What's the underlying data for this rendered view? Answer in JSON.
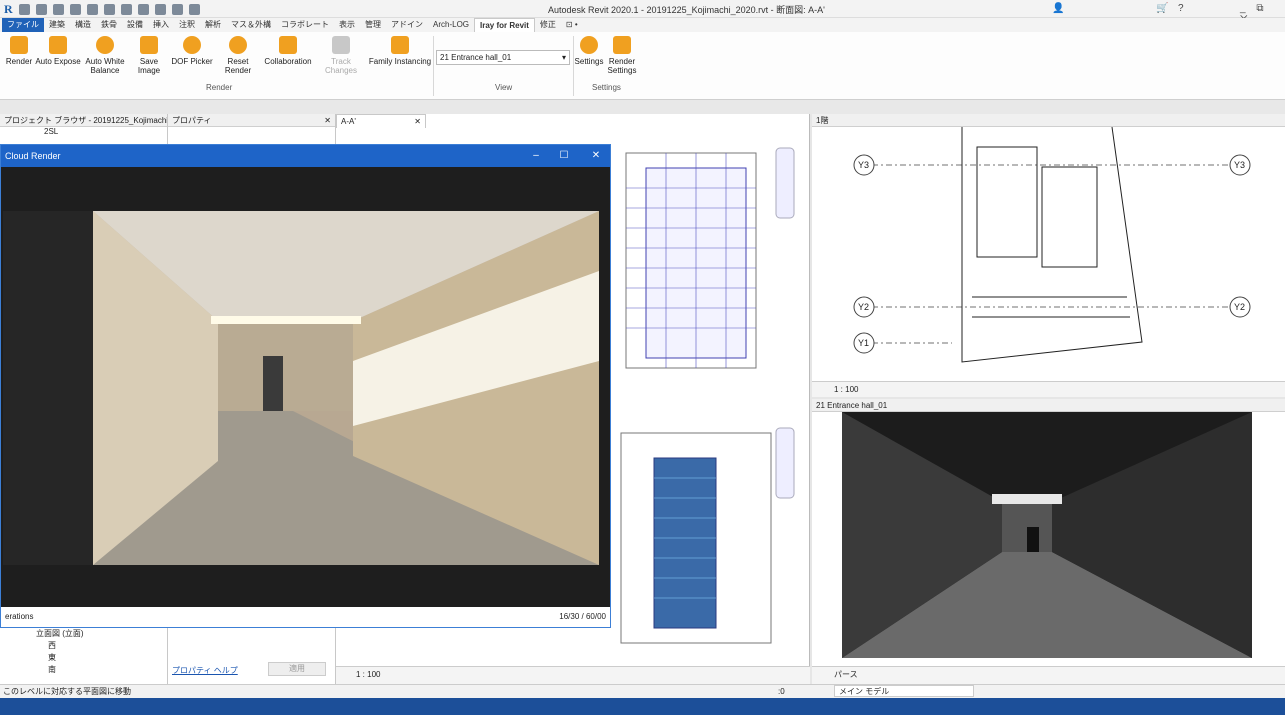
{
  "app": {
    "title": "Autodesk Revit 2020.1 - 20191225_Kojimachi_2020.rvt - 断面図: A-A'",
    "logo": "R",
    "right_icons": [
      "ribbon-user-icon",
      "cart-icon",
      "help-icon"
    ],
    "window_ctrl": "_ ⧉ ✕"
  },
  "ribbon_tabs": [
    "ファイル",
    "建築",
    "構造",
    "鉄骨",
    "設備",
    "挿入",
    "注釈",
    "解析",
    "マス＆外構",
    "コラボレート",
    "表示",
    "管理",
    "アドイン",
    "Arch-LOG",
    "Iray for Revit",
    "修正",
    "⊡ •"
  ],
  "ribbon": {
    "render_buttons": [
      {
        "label": "Render",
        "icon": "render-icon"
      },
      {
        "label": "Auto Expose",
        "icon": "auto-expose-icon"
      },
      {
        "label": "Auto White Balance",
        "icon": "sun-icon"
      },
      {
        "label": "Save Image",
        "icon": "download-icon"
      },
      {
        "label": "DOF Picker",
        "icon": "aperture-icon"
      },
      {
        "label": "Reset Render",
        "icon": "reset-icon"
      },
      {
        "label": "Collaboration",
        "icon": "collaboration-icon"
      },
      {
        "label": "Track Changes",
        "icon": "track-changes-icon"
      },
      {
        "label": "Family Instancing",
        "icon": "family-instancing-icon"
      }
    ],
    "render_group": "Render",
    "view_select": "21 Entrance hall_01",
    "view_group": "View",
    "settings_buttons": [
      {
        "label": "Settings"
      },
      {
        "label": "Render Settings"
      }
    ],
    "settings_group": "Settings"
  },
  "project_browser": {
    "title": "プロジェクト ブラウザ - 20191225_Kojimachi...",
    "items": [
      "2SL"
    ],
    "lower_items": [
      "立面図 (立面)",
      "西",
      "東",
      "南"
    ]
  },
  "properties": {
    "title": "プロパティ",
    "help": "プロパティ ヘルプ",
    "apply": "適用"
  },
  "views": {
    "section_tab": "A-A'",
    "q1_title": "1階",
    "q2_title": "21 Entrance hall_01",
    "grids": [
      "Y3",
      "Y3",
      "Y2",
      "Y2",
      "Y1"
    ],
    "scale_aa": "1 : 100",
    "scale_q1": "1 : 100",
    "q2_mode": "パース"
  },
  "cloud_render": {
    "title": "Cloud Render",
    "footer_left": "erations",
    "footer_right": "16/30 / 60/00"
  },
  "status": {
    "text": "このレベルに対応する平面図に移動",
    "model": "メイン モデル",
    "zoom": ":0"
  }
}
